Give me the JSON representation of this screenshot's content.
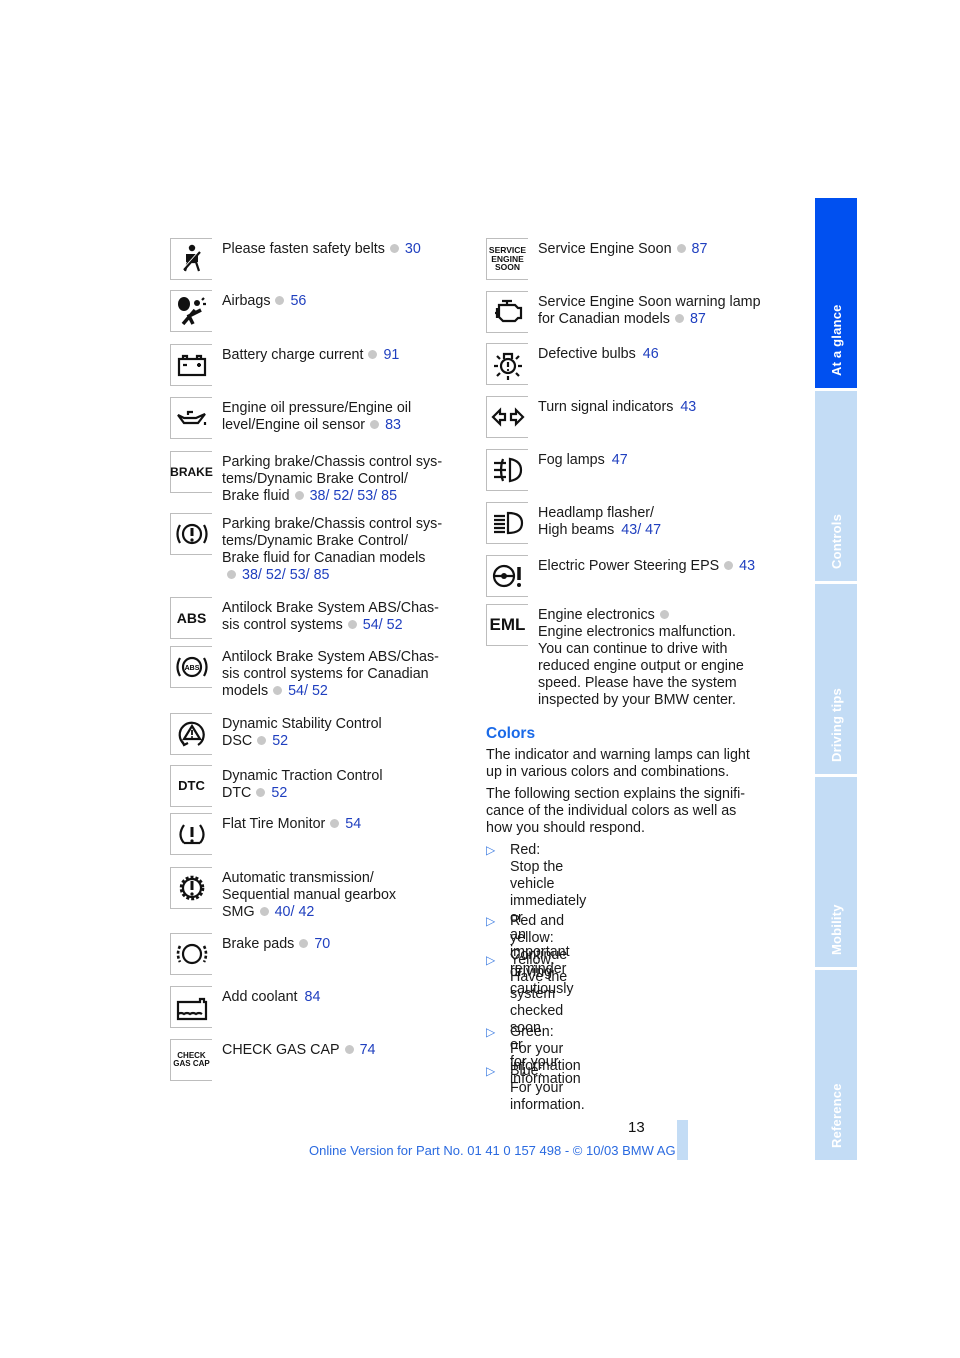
{
  "left_items": [
    {
      "icon": "seatbelt-icon",
      "lines": [
        "Please fasten safety belts"
      ],
      "dot": true,
      "pages": [
        "30"
      ]
    },
    {
      "icon": "airbag-icon",
      "lines": [
        "Airbags"
      ],
      "dot": true,
      "pages": [
        "56"
      ]
    },
    {
      "icon": "battery-icon",
      "lines": [
        "Battery charge current"
      ],
      "dot": true,
      "pages": [
        "91"
      ]
    },
    {
      "icon": "oil-can-icon",
      "lines": [
        "Engine oil pressure/Engine oil",
        "level/Engine oil sensor"
      ],
      "dot": true,
      "pages": [
        "83"
      ]
    },
    {
      "icon": "brake-text-icon",
      "icon_text": "BRAKE",
      "lines": [
        "Parking brake/Chassis control sys-",
        "tems/Dynamic Brake Control/",
        "Brake fluid"
      ],
      "dot": true,
      "pages": [
        "38",
        "52",
        "53",
        "85"
      ]
    },
    {
      "icon": "brake-warning-icon",
      "lines": [
        "Parking brake/Chassis control sys-",
        "tems/Dynamic Brake Control/",
        "Brake fluid for Canadian models",
        ""
      ],
      "dot": true,
      "pages": [
        "38",
        "52",
        "53",
        "85"
      ]
    },
    {
      "icon": "abs-text-icon",
      "icon_text": "ABS",
      "lines": [
        "Antilock Brake System ABS/Chas-",
        "sis control systems"
      ],
      "dot": true,
      "pages": [
        "54",
        "52"
      ]
    },
    {
      "icon": "abs-circle-icon",
      "lines": [
        "Antilock Brake System ABS/Chas-",
        "sis control systems for Canadian",
        "models"
      ],
      "dot": true,
      "pages": [
        "54",
        "52"
      ]
    },
    {
      "icon": "dsc-icon",
      "lines": [
        "Dynamic Stability Control",
        "DSC"
      ],
      "dot": true,
      "pages": [
        "52"
      ]
    },
    {
      "icon": "dtc-text-icon",
      "icon_text": "DTC",
      "lines": [
        "Dynamic Traction Control",
        "DTC"
      ],
      "dot": true,
      "pages": [
        "52"
      ]
    },
    {
      "icon": "flat-tire-icon",
      "lines": [
        "Flat Tire Monitor"
      ],
      "dot": true,
      "pages": [
        "54"
      ]
    },
    {
      "icon": "transmission-icon",
      "lines": [
        "Automatic transmission/",
        "Sequential manual gearbox",
        "SMG"
      ],
      "dot": true,
      "pages": [
        "40",
        "42"
      ]
    },
    {
      "icon": "brake-pads-icon",
      "lines": [
        "Brake pads"
      ],
      "dot": true,
      "pages": [
        "70"
      ]
    },
    {
      "icon": "coolant-icon",
      "lines": [
        "Add coolant"
      ],
      "dot": false,
      "pages": [
        "84"
      ]
    },
    {
      "icon": "gas-cap-text-icon",
      "icon_text": "CHECK GAS CAP",
      "lines": [
        "CHECK GAS CAP"
      ],
      "dot": true,
      "pages": [
        "74"
      ]
    }
  ],
  "right_items": [
    {
      "icon": "service-engine-soon-icon",
      "icon_text": "SERVICE ENGINE SOON",
      "lines": [
        "Service Engine Soon"
      ],
      "dot": true,
      "pages": [
        "87"
      ]
    },
    {
      "icon": "engine-icon",
      "lines": [
        "Service Engine Soon warning lamp",
        "for Canadian models"
      ],
      "dot": true,
      "pages": [
        "87"
      ]
    },
    {
      "icon": "defective-bulb-icon",
      "lines": [
        "Defective bulbs"
      ],
      "dot": false,
      "pages": [
        "46"
      ]
    },
    {
      "icon": "turn-signal-icon",
      "lines": [
        "Turn signal indicators"
      ],
      "dot": false,
      "pages": [
        "43"
      ]
    },
    {
      "icon": "fog-lamp-icon",
      "lines": [
        "Fog lamps"
      ],
      "dot": false,
      "pages": [
        "47"
      ]
    },
    {
      "icon": "high-beam-icon",
      "lines": [
        "Headlamp flasher/",
        "High beams"
      ],
      "dot": false,
      "pages": [
        "43",
        "47"
      ]
    },
    {
      "icon": "power-steering-icon",
      "lines": [
        "Electric Power Steering EPS"
      ],
      "dot": true,
      "pages": [
        "43"
      ]
    },
    {
      "icon": "eml-text-icon",
      "icon_text": "EML",
      "lines": [
        "Engine electronics"
      ],
      "dot": true,
      "pages": [],
      "extra": "Engine electronics malfunction.\nYou can continue to drive with\nreduced engine output or engine\nspeed. Please have the system\ninspected by your BMW center."
    }
  ],
  "colors_section": {
    "heading": "Colors",
    "para1": "The indicator and warning lamps can light up in various colors and combinations.",
    "para2": "The following section explains the signifi-cance of the individual colors as well as how you should respond.",
    "para1_lines": [
      "The indicator and warning lamps can light",
      "up in various colors and combinations."
    ],
    "para2_lines": [
      "The following section explains the signifi-",
      "cance of the individual colors as well as",
      "how you should respond."
    ],
    "bullets": [
      "Red:\nStop the vehicle immediately\nor\nan important reminder",
      "Red and yellow:\nContinue driving cautiously",
      "Yellow:\nHave the system checked soon\nor\nfor your information",
      "Green:\nFor your information",
      "Blue:\nFor your information."
    ]
  },
  "side_tabs": [
    {
      "label": "At a glance",
      "active": true
    },
    {
      "label": "Controls",
      "active": false
    },
    {
      "label": "Driving tips",
      "active": false
    },
    {
      "label": "Mobility",
      "active": false
    },
    {
      "label": "Reference",
      "active": false
    }
  ],
  "colors": {
    "accent": "#0050f0",
    "tab_inactive": "#c3dcf5",
    "link": "#1f3fbf",
    "heading": "#1a6ae8"
  },
  "page_number": "13",
  "footer": "Online Version for Part No. 01 41 0 157 498 - © 10/03 BMW AG"
}
